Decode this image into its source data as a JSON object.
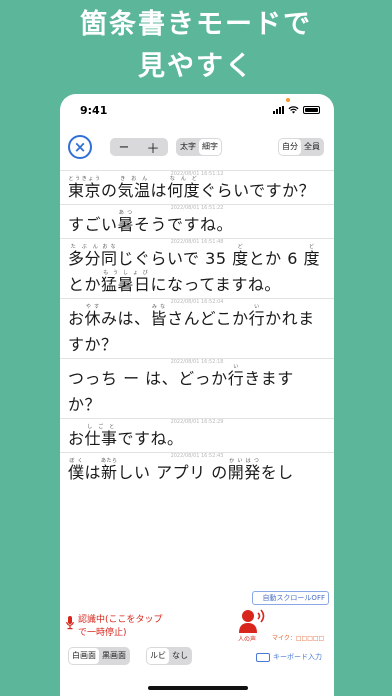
{
  "headline": {
    "line1": "箇条書きモードで",
    "line2": "見やすく"
  },
  "status_bar": {
    "time": "9:41"
  },
  "toolbar": {
    "close_icon": "×",
    "stepper_minus": "−",
    "stepper_plus": "＋",
    "font_weight_options": [
      "太字",
      "細字"
    ],
    "font_weight_selected": "細字",
    "speaker_options": [
      "自分",
      "全員"
    ],
    "speaker_selected": "自分"
  },
  "entries": [
    {
      "timestamp": "2022/08/01 16:51:12",
      "segments": [
        {
          "base": "東京",
          "ruby": "とうきょう"
        },
        {
          "base": "の"
        },
        {
          "base": "気温",
          "ruby": "きおん"
        },
        {
          "base": "は"
        },
        {
          "base": "何度",
          "ruby": "なんど"
        },
        {
          "base": "ぐらいですか？"
        }
      ]
    },
    {
      "timestamp": "2022/08/01 16:51:22",
      "segments": [
        {
          "base": "すごい"
        },
        {
          "base": "暑",
          "ruby": "あつ"
        },
        {
          "base": "そうですね。"
        }
      ]
    },
    {
      "timestamp": "2022/08/01 16:51:48",
      "segments": [
        {
          "base": "多分",
          "ruby": "たぶん"
        },
        {
          "base": "同",
          "ruby": "おな"
        },
        {
          "base": "じぐらいで 35 "
        },
        {
          "base": "度",
          "ruby": "ど"
        },
        {
          "base": "とか 6 "
        },
        {
          "base": "度",
          "ruby": "ど"
        },
        {
          "base": "とか"
        },
        {
          "base": "猛暑日",
          "ruby": "もうしょび"
        },
        {
          "base": "になってますね。"
        }
      ]
    },
    {
      "timestamp": "2022/08/01 16:52:04",
      "segments": [
        {
          "base": "お"
        },
        {
          "base": "休",
          "ruby": "やす"
        },
        {
          "base": "みは、"
        },
        {
          "base": "皆",
          "ruby": "みな"
        },
        {
          "base": "さんどこか"
        },
        {
          "base": "行",
          "ruby": "い"
        },
        {
          "base": "かれますか？"
        }
      ]
    },
    {
      "timestamp": "2022/08/01 16:52:18",
      "segments": [
        {
          "base": "つっち ー は、どっか"
        },
        {
          "base": "行",
          "ruby": "い"
        },
        {
          "base": "きますか？"
        }
      ]
    },
    {
      "timestamp": "2022/08/01 16:52:29",
      "segments": [
        {
          "base": "お"
        },
        {
          "base": "仕事",
          "ruby": "しごと"
        },
        {
          "base": "ですね。"
        }
      ]
    },
    {
      "timestamp": "2022/08/01 16:52:43",
      "segments": [
        {
          "base": "僕",
          "ruby": "ぼく"
        },
        {
          "base": "は"
        },
        {
          "base": "新",
          "ruby": "あたら"
        },
        {
          "base": "しい アプリ の"
        },
        {
          "base": "開発",
          "ruby": "かいはつ"
        },
        {
          "base": "をし"
        }
      ]
    }
  ],
  "bottom_bar": {
    "scroll_toggle_label": "自動スクロールOFF",
    "status_line1": "認識中(ここをタップ",
    "status_line2": "で一時停止)",
    "person_label": "人の声",
    "mic_level_label": "マイク：□□□□□",
    "background_options": [
      "白画面",
      "黒画面"
    ],
    "background_selected": "白画面",
    "ruby_options": [
      "ルビ",
      "なし"
    ],
    "ruby_selected": "ルビ",
    "keyboard_label": "キーボード入力"
  },
  "colors": {
    "background": "#5bb69a",
    "accent_blue": "#2f6fd6",
    "status_red": "#d8261c"
  }
}
